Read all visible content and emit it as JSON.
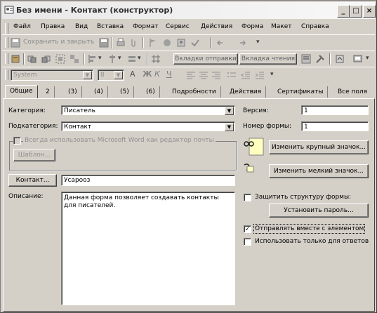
{
  "window": {
    "title": "Без имени - Контакт   (конструктор)",
    "controls": [
      "minimize",
      "maximize",
      "close"
    ]
  },
  "menubar": {
    "items": [
      {
        "label": "Файл"
      },
      {
        "label": "Правка"
      },
      {
        "label": "Вид"
      },
      {
        "label": "Вставка"
      },
      {
        "label": "Формат"
      },
      {
        "label": "Сервис"
      },
      {
        "label": "Действия"
      },
      {
        "label": "Форма"
      },
      {
        "label": "Макет"
      },
      {
        "label": "Справка"
      }
    ]
  },
  "toolbar1": {
    "save_close_label": "Сохранить и закрыть"
  },
  "toolbar2": {
    "tab_order_label": "Вкладки отправки",
    "tab_reading_label": "Вкладка чтения"
  },
  "toolbar3": {
    "font_name": "System",
    "font_size": "8"
  },
  "tabs": [
    {
      "label": "Общие"
    },
    {
      "label": "2"
    },
    {
      "label": "(3)"
    },
    {
      "label": "(4)"
    },
    {
      "label": "(5)"
    },
    {
      "label": "(6)"
    },
    {
      "label": "Подробности"
    },
    {
      "label": "Действия"
    },
    {
      "label": "Сертификаты"
    },
    {
      "label": "Все поля"
    }
  ],
  "form": {
    "category_label": "Категория:",
    "category_value": "Писатель",
    "subcategory_label": "Подкатегория:",
    "subcategory_value": "Контакт",
    "word_editor_checkbox_label": "Всегда использовать Microsoft Word как редактор почты",
    "template_button": "Шаблон...",
    "contact_button": "Контакт...",
    "contact_value": "Усарооз",
    "description_label": "Описание:",
    "description_value": "Данная форма позволяет создавать контакты для писателей.",
    "version_label": "Версия:",
    "version_value": "1",
    "form_number_label": "Номер формы:",
    "form_number_value": "1",
    "change_large_icon_button": "Изменить крупный значок...",
    "change_small_icon_button": "Изменить мелкий значок...",
    "protect_form_label": "Защитить структуру формы:",
    "protect_form_checked": false,
    "set_password_button": "Установить пароль...",
    "send_with_item_label": "Отправлять вместе с элементом",
    "send_with_item_checked": true,
    "use_for_replies_label": "Использовать только для ответов",
    "use_for_replies_checked": false
  },
  "colors": {
    "face": "#d4d0c8",
    "shadow": "#808080",
    "highlight": "#ffffff",
    "field": "#ffffff",
    "disabled_text": "#909090",
    "icon_yellow": "#ffffc0"
  }
}
